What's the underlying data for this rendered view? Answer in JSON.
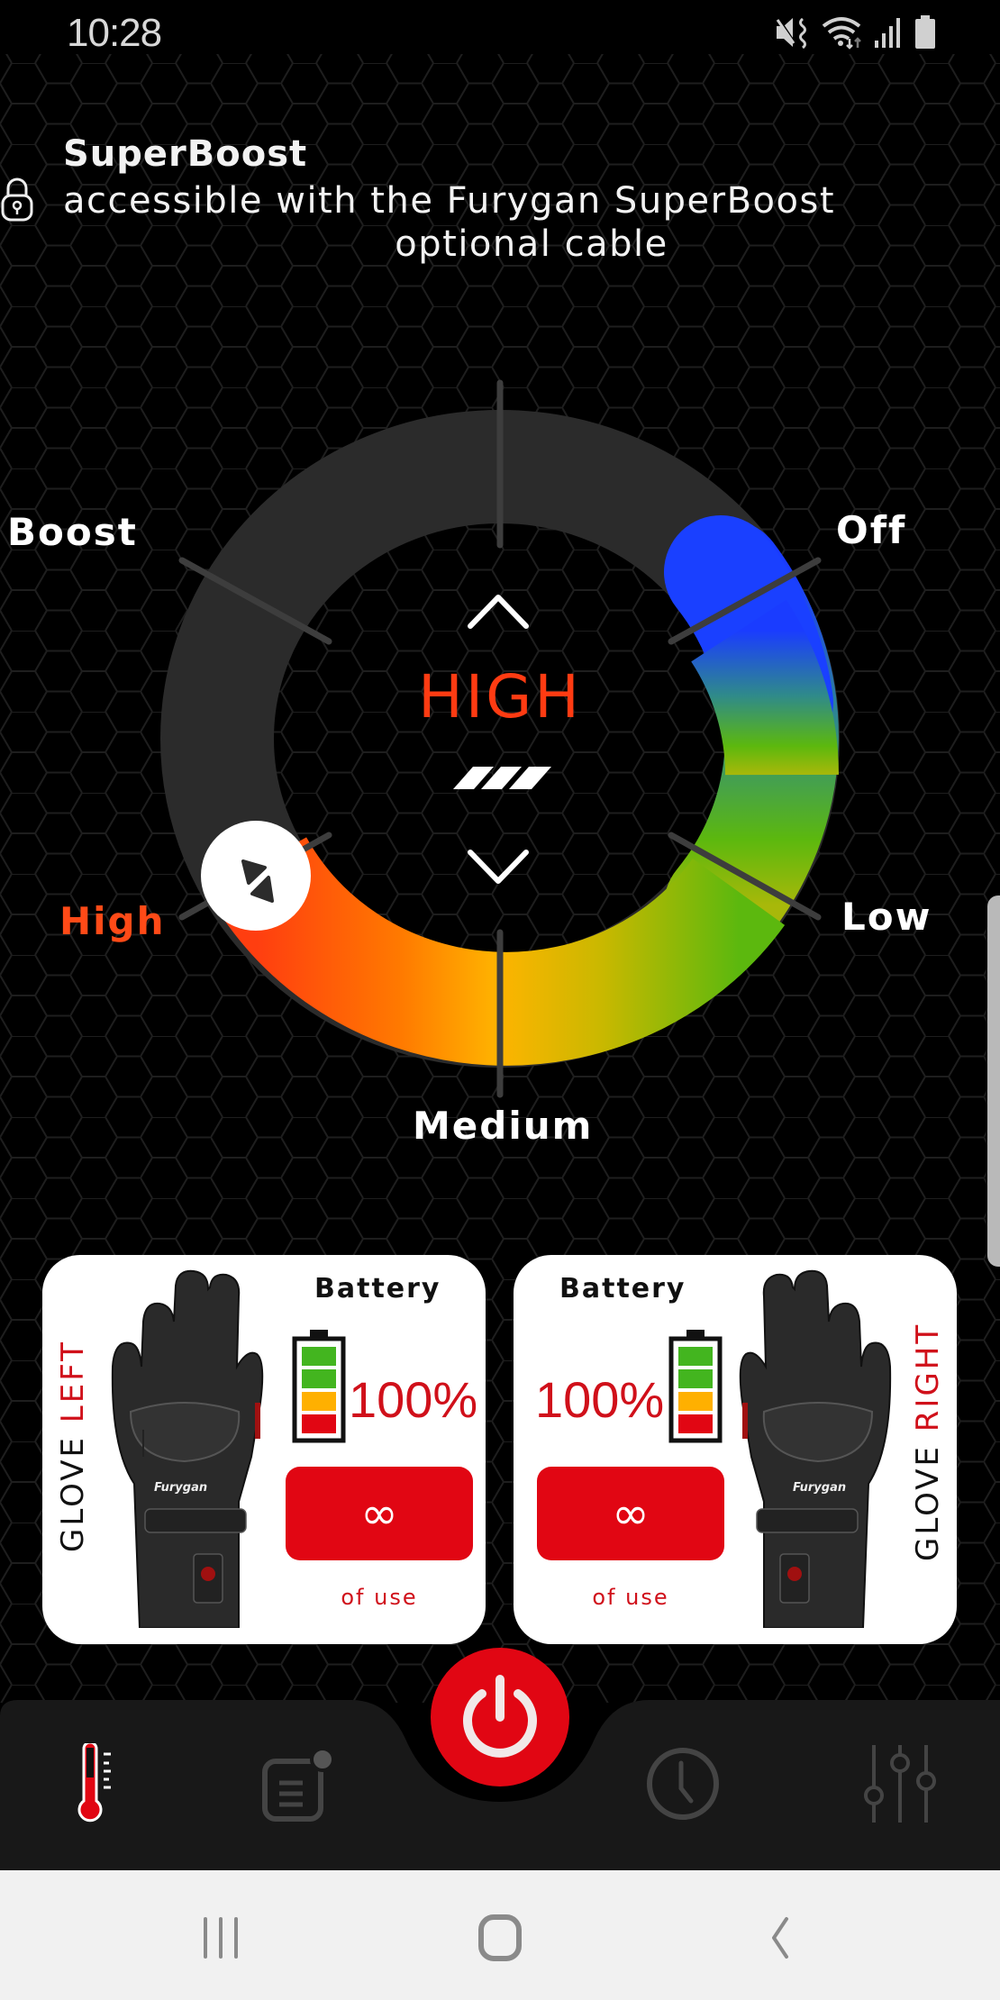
{
  "status_bar": {
    "time": "10:28",
    "icons": [
      "mute-vibrate-icon",
      "wifi-icon",
      "signal-icon",
      "battery-icon"
    ]
  },
  "superboost": {
    "title": "SuperBoost",
    "description_line1": "accessible with the Furygan SuperBoost",
    "description_line2": "optional cable",
    "lock_icon": "lock-icon"
  },
  "heat_control": {
    "levels": [
      "Off",
      "Low",
      "Medium",
      "High",
      "Boost"
    ],
    "selected_level": "High",
    "center_display": "HIGH",
    "intensity_bars": 3,
    "up_icon": "chevron-up-icon",
    "down_icon": "chevron-down-icon",
    "colors": {
      "off": "#1a3cff",
      "low": "#5cb80e",
      "medium": "#ffb000",
      "high": "#ff4a10",
      "track": "#2b2b2b",
      "active_label": "#ff4a17"
    }
  },
  "gloves": {
    "left": {
      "label_prefix": "GLOVE",
      "label_side": "LEFT",
      "battery_title": "Battery",
      "battery_percent": "100%",
      "battery_level": 1.0,
      "usage_value": "∞",
      "usage_label": "of use"
    },
    "right": {
      "label_prefix": "GLOVE",
      "label_side": "RIGHT",
      "battery_title": "Battery",
      "battery_percent": "100%",
      "battery_level": 1.0,
      "usage_value": "∞",
      "usage_label": "of use"
    }
  },
  "bottom_nav": {
    "items": [
      {
        "name": "heating",
        "icon": "thermometer-icon",
        "active": true
      },
      {
        "name": "notes",
        "icon": "note-icon",
        "active": false
      },
      {
        "name": "timer",
        "icon": "clock-icon",
        "active": false
      },
      {
        "name": "settings",
        "icon": "sliders-icon",
        "active": false
      }
    ],
    "power_icon": "power-icon",
    "accent": "#e10613"
  },
  "system_nav": {
    "buttons": [
      "recent-apps",
      "home",
      "back"
    ]
  }
}
